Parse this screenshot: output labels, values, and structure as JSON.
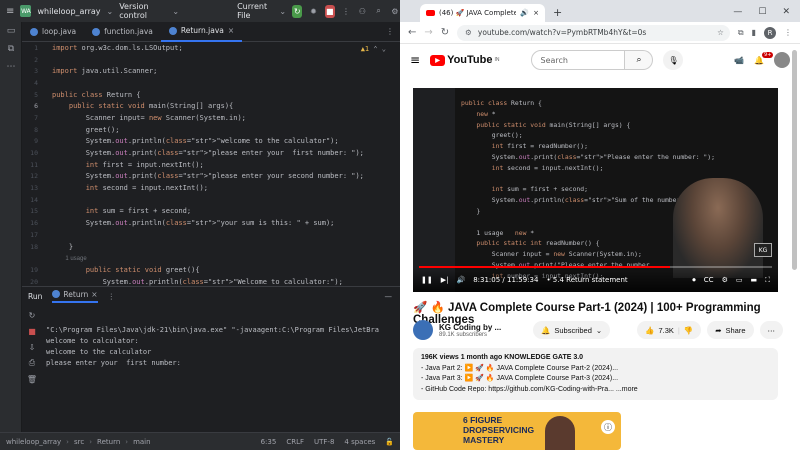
{
  "ide": {
    "project_badge": "WA",
    "project_name": "whileloop_array",
    "vcs": "Version control",
    "run_config": "Current File",
    "tabs": [
      "loop.java",
      "function.java",
      "Return.java"
    ],
    "editor_lines": [
      {
        "n": "1",
        "t": "import org.w3c.dom.ls.LSOutput;"
      },
      {
        "n": "2",
        "t": ""
      },
      {
        "n": "3",
        "t": "import java.util.Scanner;"
      },
      {
        "n": "4",
        "t": ""
      },
      {
        "n": "5",
        "t": "public class Return {"
      },
      {
        "n": "6",
        "t": "    public static void main(String[] args){"
      },
      {
        "n": "7",
        "t": "        Scanner input= new Scanner(System.in);"
      },
      {
        "n": "8",
        "t": "        greet();"
      },
      {
        "n": "9",
        "t": "        System.out.println(\"welcome to the calculator\");"
      },
      {
        "n": "10",
        "t": "        System.out.print(\"please enter your  first number: \");"
      },
      {
        "n": "11",
        "t": "        int first = input.nextInt();"
      },
      {
        "n": "12",
        "t": "        System.out.print(\"please enter your second number: \");"
      },
      {
        "n": "13",
        "t": "        int second = input.nextInt();"
      },
      {
        "n": "14",
        "t": ""
      },
      {
        "n": "15",
        "t": "        int sum = first + second;"
      },
      {
        "n": "16",
        "t": "        System.out.println(\"your sum is this: \" + sum);"
      },
      {
        "n": "17",
        "t": ""
      },
      {
        "n": "18",
        "t": "    }"
      },
      {
        "n": "",
        "t": "        1 usage"
      },
      {
        "n": "19",
        "t": "        public static void greet(){"
      },
      {
        "n": "20",
        "t": "            System.out.println(\"Welcome to calculator:\");"
      }
    ],
    "warning_count": "1",
    "run_tabs": [
      "Run",
      "Return"
    ],
    "console_lines": [
      "\"C:\\Program Files\\Java\\jdk-21\\bin\\java.exe\" \"-javaagent:C:\\Program Files\\JetBra",
      "welcome to calculator:",
      "welcome to the calculator",
      "please enter your  first number:"
    ],
    "status": {
      "crumbs": [
        "whileloop_array",
        "src",
        "Return",
        "main"
      ],
      "pos": "6:35",
      "eol": "CRLF",
      "enc": "UTF-8",
      "indent": "4 spaces"
    }
  },
  "browser": {
    "tab_title": "(46) 🚀 JAVA Complete",
    "url": "youtube.com/watch?v=PymbRTMb4hY&t=0s",
    "profile": "R",
    "yt": {
      "logo": "YouTube",
      "region": "IN",
      "search_placeholder": "Search",
      "notif_count": "9+",
      "video_code": [
        "public class Return {",
        "    new *",
        "    public static void main(String[] args) {",
        "        greet();",
        "        int first = readNumber();",
        "        System.out.print(\"Please enter the number: \");",
        "        int second = input.nextInt();",
        "",
        "        int sum = first + second;",
        "        System.out.println(\"Sum of the numbers is: \" + sum);",
        "    }",
        "",
        "    1 usage   new *",
        "    public static int readNumber() {",
        "        Scanner input = new Scanner(System.in);",
        "        System.out.print(\"Please enter the number",
        "        int number = input.nextInt();"
      ],
      "kg_badge": "KG",
      "time": "8:31:05 / 11:59:34",
      "chapter": "• 5.4 Return statement",
      "progress": 0.71,
      "title": "🚀 🔥 JAVA Complete Course Part-1 (2024) | 100+ Programming Challenges",
      "channel": "KG Coding by ...",
      "subs": "89.1K subscribers",
      "subscribed": "Subscribed",
      "likes": "7.3K",
      "share": "Share",
      "views_line": "196K views  1 month ago  KNOWLEDGE GATE 3.0",
      "desc_lines": [
        "- Java Part 2:  ▶️ 🚀 🔥 JAVA Complete Course Part-2 (2024)...",
        "- Java Part 3:  ▶️ 🚀 🔥 JAVA Complete Course Part-3 (2024)...",
        "- GitHub Code Repo: https://github.com/KG-Coding-with-Pra...  ...more"
      ],
      "ad_lines": [
        "6 FIGURE",
        "DROPSERVICING",
        "MASTERY"
      ]
    }
  },
  "colors": {
    "accent": "#3574f0",
    "yt_red": "#ff0000",
    "ide_bg": "#1e1f22"
  }
}
